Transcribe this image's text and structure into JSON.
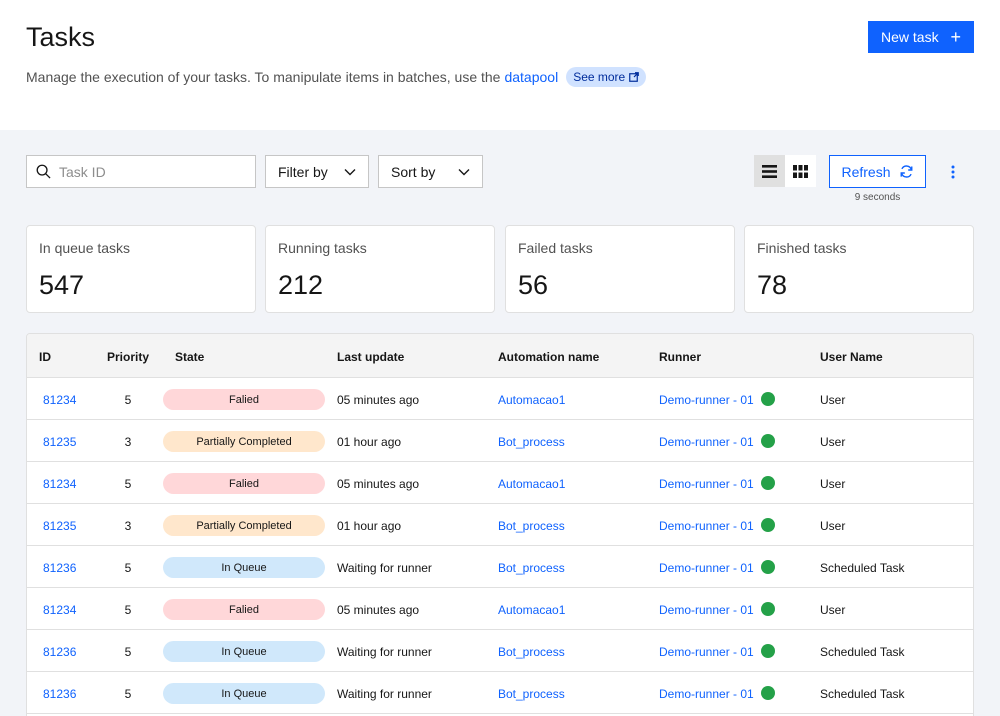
{
  "header": {
    "title": "Tasks",
    "subtitle_text": "Manage the execution of your tasks. To manipulate items in batches, use the",
    "subtitle_link": "datapool",
    "see_more_label": "See more",
    "new_task_label": "New task",
    "new_task_icon": "plus-icon"
  },
  "toolbar": {
    "search_placeholder": "Task ID",
    "filter_label": "Filter by",
    "sort_label": "Sort by",
    "refresh_label": "Refresh",
    "refresh_timer": "9 seconds",
    "active_view": "list"
  },
  "stats": [
    {
      "label": "In queue tasks",
      "value": "547"
    },
    {
      "label": "Running tasks",
      "value": "212"
    },
    {
      "label": "Failed tasks",
      "value": "56"
    },
    {
      "label": "Finished tasks",
      "value": "78"
    }
  ],
  "table": {
    "columns": [
      "ID",
      "Priority",
      "State",
      "Last update",
      "Automation name",
      "Runner",
      "User  Name"
    ],
    "rows": [
      {
        "id": "81234",
        "priority": "5",
        "state": "Falied",
        "last_update": "05 minutes ago",
        "automation": "Automacao1",
        "runner": "Demo-runner - 01",
        "user": "User"
      },
      {
        "id": "81235",
        "priority": "3",
        "state": "Partially Completed",
        "last_update": "01 hour ago",
        "automation": "Bot_process",
        "runner": "Demo-runner - 01",
        "user": "User"
      },
      {
        "id": "81234",
        "priority": "5",
        "state": "Falied",
        "last_update": "05 minutes ago",
        "automation": "Automacao1",
        "runner": "Demo-runner - 01",
        "user": "User"
      },
      {
        "id": "81235",
        "priority": "3",
        "state": "Partially Completed",
        "last_update": "01 hour ago",
        "automation": "Bot_process",
        "runner": "Demo-runner - 01",
        "user": "User"
      },
      {
        "id": "81236",
        "priority": "5",
        "state": "In Queue",
        "last_update": "Waiting for runner",
        "automation": "Bot_process",
        "runner": "Demo-runner - 01",
        "user": "Scheduled Task"
      },
      {
        "id": "81234",
        "priority": "5",
        "state": "Falied",
        "last_update": "05 minutes ago",
        "automation": "Automacao1",
        "runner": "Demo-runner - 01",
        "user": "User"
      },
      {
        "id": "81236",
        "priority": "5",
        "state": "In Queue",
        "last_update": "Waiting for runner",
        "automation": "Bot_process",
        "runner": "Demo-runner - 01",
        "user": "Scheduled Task"
      },
      {
        "id": "81236",
        "priority": "5",
        "state": "In Queue",
        "last_update": "Waiting for runner",
        "automation": "Bot_process",
        "runner": "Demo-runner - 01",
        "user": "Scheduled Task"
      }
    ],
    "runner_status_color": "#24a148"
  },
  "colors": {
    "accent": "#0f62fe",
    "state_failed": "#ffd7d9",
    "state_partial": "#ffe7cc",
    "state_queue": "#d0e8fb"
  }
}
